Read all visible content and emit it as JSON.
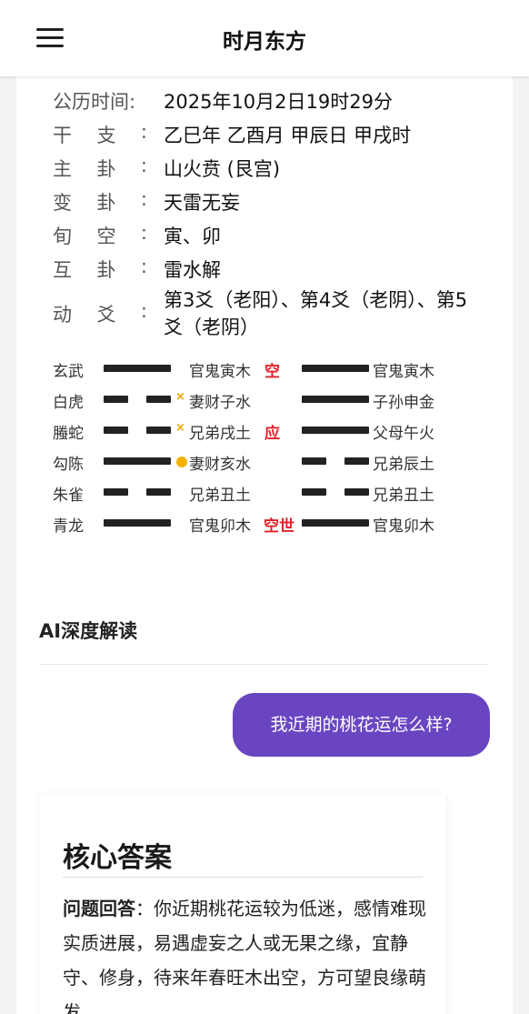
{
  "header": {
    "title": "时月东方",
    "menu_icon": "hamburger-menu-icon"
  },
  "info": {
    "gregorian_label": "公历时间:",
    "gregorian_value": "2025年10月2日19时29分",
    "ganzhi_label": [
      "干",
      "支"
    ],
    "ganzhi_value": "乙巳年 乙酉月 甲辰日 甲戌时",
    "main_gua_label": [
      "主",
      "卦"
    ],
    "main_gua_value": "山火贲 (艮宫)",
    "change_gua_label": [
      "变",
      "卦"
    ],
    "change_gua_value": "天雷无妄",
    "xunkong_label": [
      "旬",
      "空"
    ],
    "xunkong_value": "寅、卯",
    "hu_gua_label": [
      "互",
      "卦"
    ],
    "hu_gua_value": "雷水解",
    "moving_label": [
      "动",
      "爻"
    ],
    "moving_value": "第3爻（老阳）、第4爻（老阴）、第5爻（老阴）",
    "colon": ":"
  },
  "yao_lines": [
    {
      "god": "玄武",
      "left_type": "yang",
      "marker": "",
      "left_rel": "官鬼寅木",
      "tag": "空",
      "right_type": "yang",
      "right_rel": "官鬼寅木"
    },
    {
      "god": "白虎",
      "left_type": "yin",
      "marker": "x",
      "left_rel": "妻财子水",
      "tag": "",
      "right_type": "yang",
      "right_rel": "子孙申金"
    },
    {
      "god": "螣蛇",
      "left_type": "yin",
      "marker": "x",
      "left_rel": "兄弟戌土",
      "tag": "应",
      "right_type": "yang",
      "right_rel": "父母午火"
    },
    {
      "god": "勾陈",
      "left_type": "yang",
      "marker": "o",
      "left_rel": "妻财亥水",
      "tag": "",
      "right_type": "yin",
      "right_rel": "兄弟辰土"
    },
    {
      "god": "朱雀",
      "left_type": "yin",
      "marker": "",
      "left_rel": "兄弟丑土",
      "tag": "",
      "right_type": "yin",
      "right_rel": "兄弟丑土"
    },
    {
      "god": "青龙",
      "left_type": "yang",
      "marker": "",
      "left_rel": "官鬼卯木",
      "tag": "空世",
      "right_type": "yang",
      "right_rel": "官鬼卯木"
    }
  ],
  "ai": {
    "section_title": "AI深度解读",
    "user_question": "我近期的桃花运怎么样?",
    "answer_title": "核心答案",
    "answer_label": "问题回答",
    "answer_text": "：你近期桃花运较为低迷，感情难现实质进展，易遇虚妄之人或无果之缘，宜静守、修身，待来年春旺木出空，方可望良缘萌发。"
  },
  "colors": {
    "accent": "#6a45c2",
    "tag_red": "#e0242c",
    "marker_orange": "#f0a500"
  }
}
